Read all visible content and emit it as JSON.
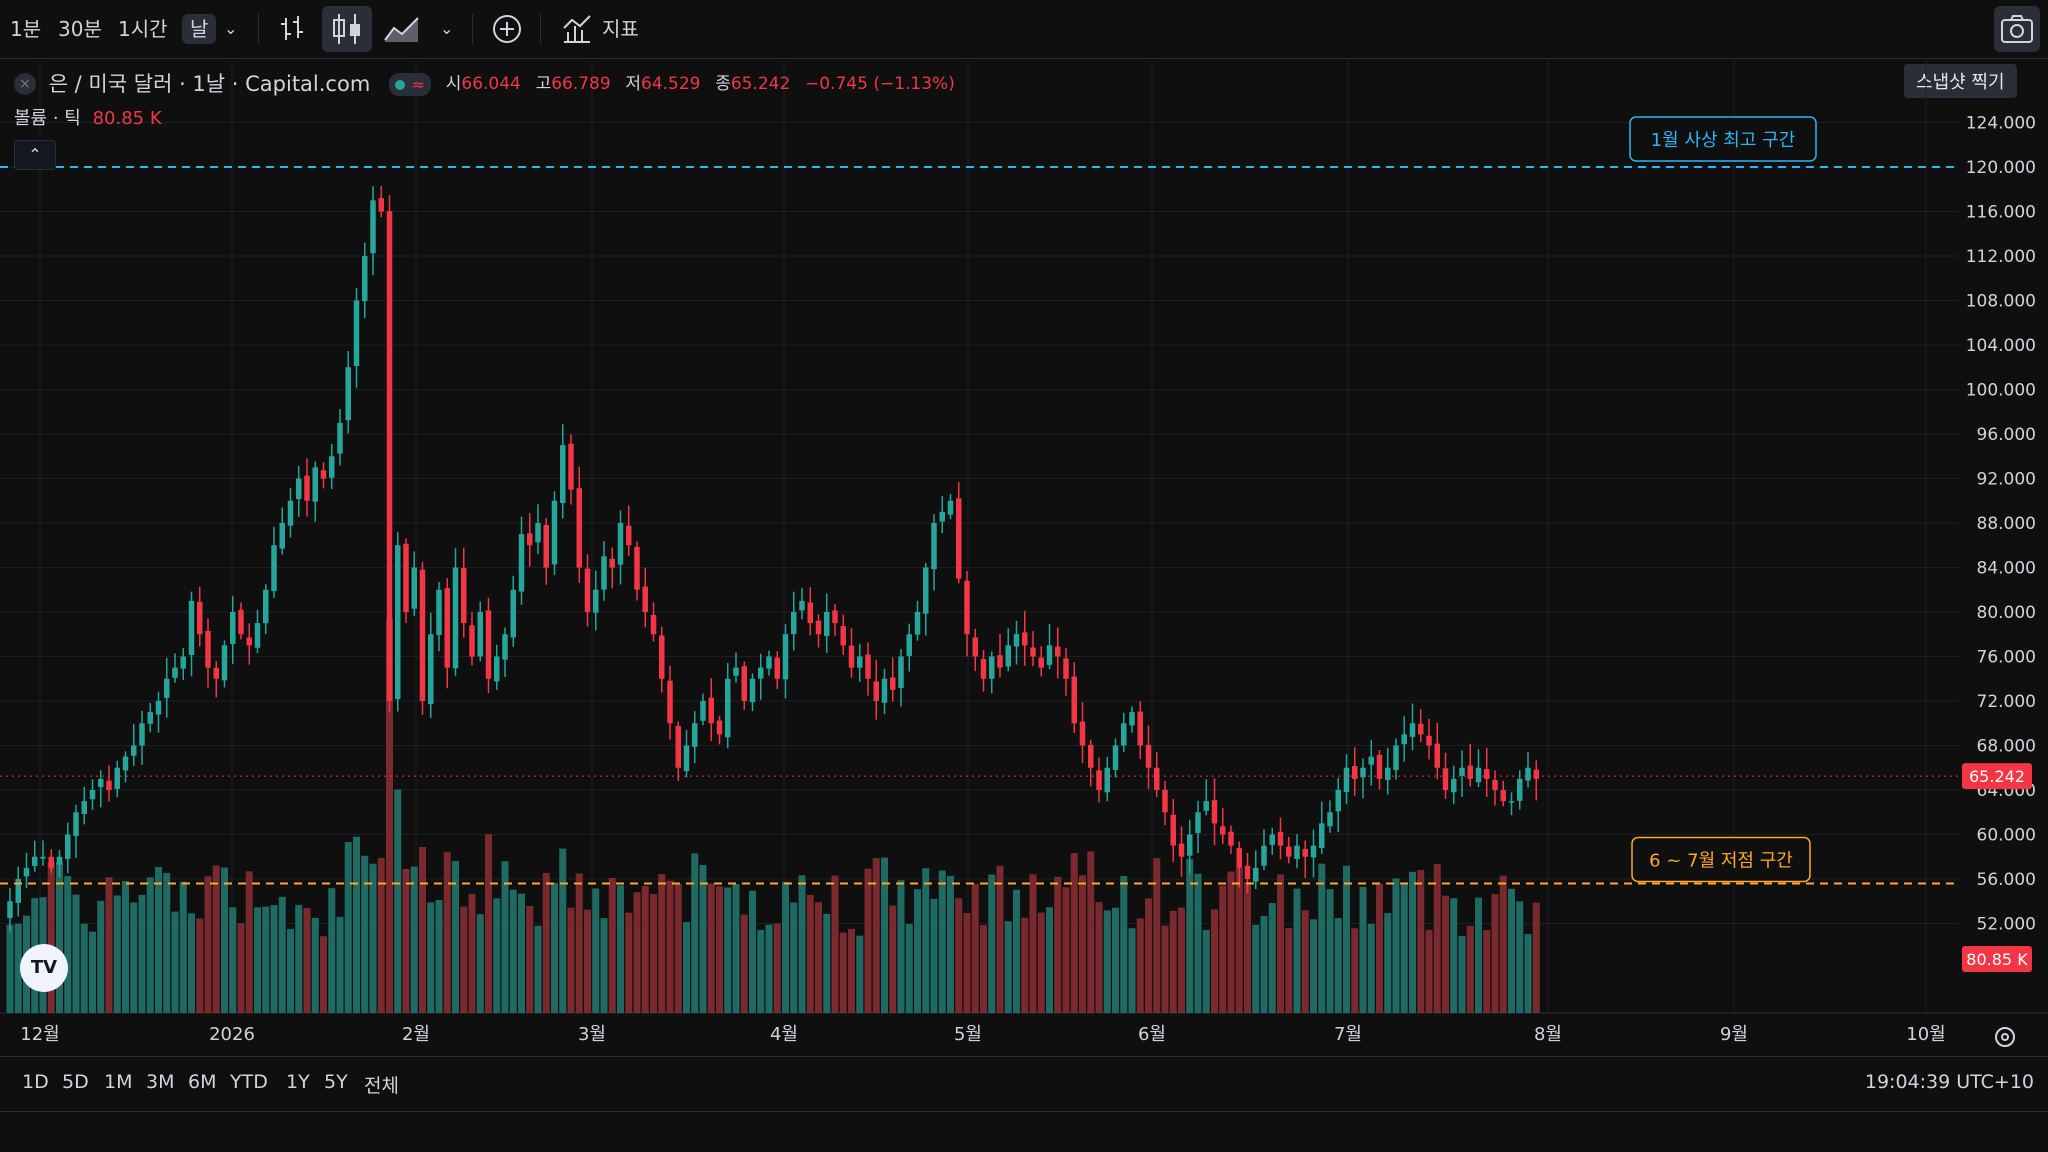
{
  "toolbar": {
    "intervals": [
      "1분",
      "30분",
      "1시간",
      "날"
    ],
    "indicators_label": "지표",
    "snapshot_tooltip": "스냅샷 찍기"
  },
  "legend": {
    "symbol": "은 / 미국 달러 · 1날 · Capital.com",
    "open_label": "시",
    "open": "66.044",
    "high_label": "고",
    "high": "66.789",
    "low_label": "저",
    "low": "64.529",
    "close_label": "종",
    "close": "65.242",
    "change": "−0.745 (−1.13%)",
    "volume_label": "볼륨 · 틱",
    "volume_value": "80.85 K"
  },
  "price_axis": [
    "124.000",
    "120.000",
    "116.000",
    "112.000",
    "108.000",
    "104.000",
    "100.000",
    "96.000",
    "92.000",
    "88.000",
    "84.000",
    "80.000",
    "76.000",
    "72.000",
    "68.000",
    "64.000",
    "60.000",
    "56.000",
    "52.000"
  ],
  "time_axis": [
    "12월",
    "2026",
    "2월",
    "3월",
    "4월",
    "5월",
    "6월",
    "7월",
    "8월",
    "9월",
    "10월"
  ],
  "range_buttons": [
    "1D",
    "5D",
    "1M",
    "3M",
    "6M",
    "YTD",
    "1Y",
    "5Y",
    "전체"
  ],
  "clock": "19:04:39 UTC+10",
  "colors": {
    "up": "#26a69a",
    "down": "#f23645",
    "up_vol": "#1f6b64",
    "down_vol": "#7a2a2e",
    "annotation_high": "#29b6f6",
    "annotation_low": "#ffa726"
  },
  "chart_data": {
    "type": "candlestick",
    "title": "은 / 미국 달러 · 1날 · Capital.com",
    "ylim": [
      49,
      127
    ],
    "grid": true,
    "annotations": [
      {
        "label": "1월 사상 최고 구간",
        "price": 120.0,
        "color": "#29b6f6"
      },
      {
        "label": "6 ~ 7월 저점 구간",
        "price": 55.6,
        "color": "#ffa726"
      }
    ],
    "last_price": "65.242",
    "last_volume": "80.85 K",
    "closes": [
      54,
      56,
      57,
      58,
      58,
      57,
      58,
      60,
      62,
      63,
      64,
      65,
      64,
      66,
      67,
      68,
      70,
      71,
      72,
      74,
      75,
      76,
      81,
      78,
      75,
      74,
      77,
      80,
      78,
      77,
      79,
      82,
      86,
      88,
      90,
      92,
      90,
      93,
      92,
      94,
      97,
      102,
      108,
      112,
      117,
      116,
      72,
      86,
      80,
      84,
      72,
      78,
      82,
      75,
      84,
      79,
      76,
      80,
      74,
      76,
      78,
      82,
      87,
      86,
      88,
      84,
      90,
      95,
      91,
      84,
      80,
      82,
      85,
      84,
      88,
      86,
      82,
      80,
      78,
      74,
      70,
      66,
      68,
      70,
      72,
      70,
      69,
      74,
      75,
      72,
      74,
      75,
      76,
      74,
      78,
      80,
      81,
      79,
      78,
      80,
      79,
      77,
      75,
      76,
      74,
      72,
      74,
      73,
      76,
      78,
      80,
      84,
      88,
      89,
      90,
      83,
      78,
      76,
      74,
      76,
      75,
      77,
      78,
      77,
      76,
      75,
      77,
      76,
      74,
      70,
      68,
      66,
      64,
      66,
      68,
      70,
      71,
      68,
      66,
      64,
      62,
      59,
      58,
      60,
      62,
      63,
      61,
      60,
      59,
      57,
      56,
      57,
      59,
      60,
      59,
      58,
      59,
      58,
      59,
      61,
      62,
      64,
      66,
      65,
      66,
      67,
      65,
      66,
      68,
      69,
      70,
      69,
      68,
      66,
      64,
      65,
      66,
      65,
      66,
      65,
      64,
      63,
      63,
      65,
      66,
      65
    ]
  }
}
